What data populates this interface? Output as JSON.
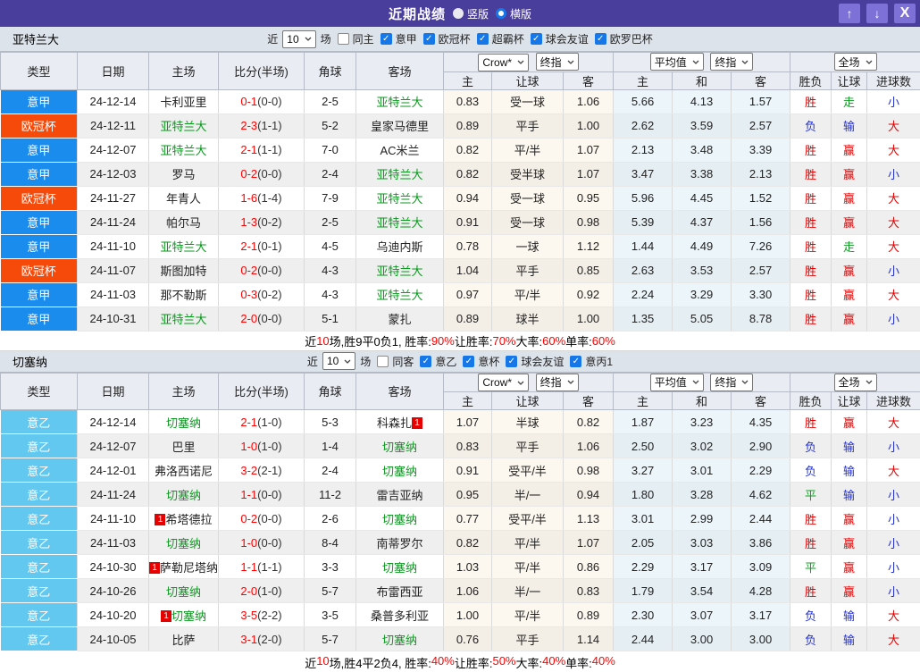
{
  "titlebar": {
    "title": "近期战绩",
    "radios": [
      {
        "label": "竖版",
        "style": "filled"
      },
      {
        "label": "横版",
        "style": "ring"
      }
    ],
    "up_icon": "↑",
    "down_icon": "↓",
    "close_icon": "X"
  },
  "header": {
    "type": "类型",
    "date": "日期",
    "home": "主场",
    "score": "比分(半场)",
    "corner": "角球",
    "away": "客场",
    "odds_company": "Crow*",
    "odds_mode": "终指",
    "avg_label": "平均值",
    "avg_mode": "终指",
    "scope_label": "全场",
    "odds_home": "主",
    "odds_handicap": "让球",
    "odds_away": "客",
    "avg_home": "主",
    "avg_draw": "和",
    "avg_away": "客",
    "res_winloss": "胜负",
    "res_handicap": "让球",
    "res_goals": "进球数"
  },
  "colors": {
    "titlebar": "#4a3e9d",
    "accent_red": "#ff0000",
    "team_green": "#0a9a1e",
    "leagues": {
      "意甲": "#1a8ced",
      "欧冠杯": "#f54a0a",
      "意乙": "#62c8ef"
    },
    "outcomes": {
      "胜": "#e60000",
      "平": "#0f9d23",
      "负": "#2633cc",
      "赢": "#e60000",
      "输": "#2633cc",
      "走": "#0f9d23",
      "大": "#e60000",
      "小": "#2633cc"
    }
  },
  "sections": [
    {
      "team": "亚特兰大",
      "filter": {
        "near_label": "近",
        "count": "10",
        "games_label": "场",
        "same": {
          "label": "同主",
          "checked": false
        },
        "leagues": [
          {
            "label": "意甲",
            "checked": true
          },
          {
            "label": "欧冠杯",
            "checked": true
          },
          {
            "label": "超霸杯",
            "checked": true
          },
          {
            "label": "球会友谊",
            "checked": true
          },
          {
            "label": "欧罗巴杯",
            "checked": true
          }
        ]
      },
      "rows": [
        {
          "lg": "意甲",
          "d": "24-12-14",
          "h": "卡利亚里",
          "hg": false,
          "s": "0-1",
          "sh": "(0-0)",
          "cn": "2-5",
          "a": "亚特兰大",
          "ag": true,
          "o1": "0.83",
          "hc": "受一球",
          "o2": "1.06",
          "m1": "5.66",
          "m2": "4.13",
          "m3": "1.57",
          "wl": "胜",
          "hd": "走",
          "gl": "小"
        },
        {
          "lg": "欧冠杯",
          "d": "24-12-11",
          "h": "亚特兰大",
          "hg": true,
          "s": "2-3",
          "sh": "(1-1)",
          "cn": "5-2",
          "a": "皇家马德里",
          "ag": false,
          "o1": "0.89",
          "hc": "平手",
          "o2": "1.00",
          "m1": "2.62",
          "m2": "3.59",
          "m3": "2.57",
          "wl": "负",
          "hd": "输",
          "gl": "大"
        },
        {
          "lg": "意甲",
          "d": "24-12-07",
          "h": "亚特兰大",
          "hg": true,
          "s": "2-1",
          "sh": "(1-1)",
          "cn": "7-0",
          "a": "AC米兰",
          "ag": false,
          "o1": "0.82",
          "hc": "平/半",
          "o2": "1.07",
          "m1": "2.13",
          "m2": "3.48",
          "m3": "3.39",
          "wl": "胜",
          "hd": "赢",
          "gl": "大"
        },
        {
          "lg": "意甲",
          "d": "24-12-03",
          "h": "罗马",
          "hg": false,
          "s": "0-2",
          "sh": "(0-0)",
          "cn": "2-4",
          "a": "亚特兰大",
          "ag": true,
          "o1": "0.82",
          "hc": "受半球",
          "o2": "1.07",
          "m1": "3.47",
          "m2": "3.38",
          "m3": "2.13",
          "wl": "胜",
          "hd": "赢",
          "gl": "小"
        },
        {
          "lg": "欧冠杯",
          "d": "24-11-27",
          "h": "年青人",
          "hg": false,
          "s": "1-6",
          "sh": "(1-4)",
          "cn": "7-9",
          "a": "亚特兰大",
          "ag": true,
          "o1": "0.94",
          "hc": "受一球",
          "o2": "0.95",
          "m1": "5.96",
          "m2": "4.45",
          "m3": "1.52",
          "wl": "胜",
          "hd": "赢",
          "gl": "大"
        },
        {
          "lg": "意甲",
          "d": "24-11-24",
          "h": "帕尔马",
          "hg": false,
          "s": "1-3",
          "sh": "(0-2)",
          "cn": "2-5",
          "a": "亚特兰大",
          "ag": true,
          "o1": "0.91",
          "hc": "受一球",
          "o2": "0.98",
          "m1": "5.39",
          "m2": "4.37",
          "m3": "1.56",
          "wl": "胜",
          "hd": "赢",
          "gl": "大"
        },
        {
          "lg": "意甲",
          "d": "24-11-10",
          "h": "亚特兰大",
          "hg": true,
          "s": "2-1",
          "sh": "(0-1)",
          "cn": "4-5",
          "a": "乌迪内斯",
          "ag": false,
          "o1": "0.78",
          "hc": "一球",
          "o2": "1.12",
          "m1": "1.44",
          "m2": "4.49",
          "m3": "7.26",
          "wl": "胜",
          "hd": "走",
          "gl": "大"
        },
        {
          "lg": "欧冠杯",
          "d": "24-11-07",
          "h": "斯图加特",
          "hg": false,
          "s": "0-2",
          "sh": "(0-0)",
          "cn": "4-3",
          "a": "亚特兰大",
          "ag": true,
          "o1": "1.04",
          "hc": "平手",
          "o2": "0.85",
          "m1": "2.63",
          "m2": "3.53",
          "m3": "2.57",
          "wl": "胜",
          "hd": "赢",
          "gl": "小"
        },
        {
          "lg": "意甲",
          "d": "24-11-03",
          "h": "那不勒斯",
          "hg": false,
          "s": "0-3",
          "sh": "(0-2)",
          "cn": "4-3",
          "a": "亚特兰大",
          "ag": true,
          "o1": "0.97",
          "hc": "平/半",
          "o2": "0.92",
          "m1": "2.24",
          "m2": "3.29",
          "m3": "3.30",
          "wl": "胜",
          "hd": "赢",
          "gl": "大"
        },
        {
          "lg": "意甲",
          "d": "24-10-31",
          "h": "亚特兰大",
          "hg": true,
          "s": "2-0",
          "sh": "(0-0)",
          "cn": "5-1",
          "a": "蒙扎",
          "ag": false,
          "o1": "0.89",
          "hc": "球半",
          "o2": "1.00",
          "m1": "1.35",
          "m2": "5.05",
          "m3": "8.78",
          "wl": "胜",
          "hd": "赢",
          "gl": "小"
        }
      ],
      "summary": [
        {
          "t": "近"
        },
        {
          "t": "10",
          "red": true
        },
        {
          "t": "场,胜9平0负1, 胜率:"
        },
        {
          "t": "90%",
          "red": true
        },
        {
          "t": " 让胜率:"
        },
        {
          "t": "70%",
          "red": true
        },
        {
          "t": " 大率:"
        },
        {
          "t": "60%",
          "red": true
        },
        {
          "t": " 单率:"
        },
        {
          "t": "60%",
          "red": true
        }
      ]
    },
    {
      "team": "切塞纳",
      "filter": {
        "near_label": "近",
        "count": "10",
        "games_label": "场",
        "same": {
          "label": "同客",
          "checked": false
        },
        "leagues": [
          {
            "label": "意乙",
            "checked": true
          },
          {
            "label": "意杯",
            "checked": true
          },
          {
            "label": "球会友谊",
            "checked": true
          },
          {
            "label": "意丙1",
            "checked": true
          }
        ]
      },
      "rows": [
        {
          "lg": "意乙",
          "d": "24-12-14",
          "h": "切塞纳",
          "hg": true,
          "s": "2-1",
          "sh": "(1-0)",
          "cn": "5-3",
          "a": "科森扎",
          "ag": false,
          "aa": "1",
          "o1": "1.07",
          "hc": "半球",
          "o2": "0.82",
          "m1": "1.87",
          "m2": "3.23",
          "m3": "4.35",
          "wl": "胜",
          "hd": "赢",
          "gl": "大"
        },
        {
          "lg": "意乙",
          "d": "24-12-07",
          "h": "巴里",
          "hg": false,
          "s": "1-0",
          "sh": "(1-0)",
          "cn": "1-4",
          "a": "切塞纳",
          "ag": true,
          "o1": "0.83",
          "hc": "平手",
          "o2": "1.06",
          "m1": "2.50",
          "m2": "3.02",
          "m3": "2.90",
          "wl": "负",
          "hd": "输",
          "gl": "小"
        },
        {
          "lg": "意乙",
          "d": "24-12-01",
          "h": "弗洛西诺尼",
          "hg": false,
          "s": "3-2",
          "sh": "(2-1)",
          "cn": "2-4",
          "a": "切塞纳",
          "ag": true,
          "o1": "0.91",
          "hc": "受平/半",
          "o2": "0.98",
          "m1": "3.27",
          "m2": "3.01",
          "m3": "2.29",
          "wl": "负",
          "hd": "输",
          "gl": "大"
        },
        {
          "lg": "意乙",
          "d": "24-11-24",
          "h": "切塞纳",
          "hg": true,
          "s": "1-1",
          "sh": "(0-0)",
          "cn": "11-2",
          "a": "雷吉亚纳",
          "ag": false,
          "o1": "0.95",
          "hc": "半/一",
          "o2": "0.94",
          "m1": "1.80",
          "m2": "3.28",
          "m3": "4.62",
          "wl": "平",
          "hd": "输",
          "gl": "小"
        },
        {
          "lg": "意乙",
          "d": "24-11-10",
          "h": "希塔德拉",
          "hg": false,
          "hb": "1",
          "s": "0-2",
          "sh": "(0-0)",
          "cn": "2-6",
          "a": "切塞纳",
          "ag": true,
          "o1": "0.77",
          "hc": "受平/半",
          "o2": "1.13",
          "m1": "3.01",
          "m2": "2.99",
          "m3": "2.44",
          "wl": "胜",
          "hd": "赢",
          "gl": "小"
        },
        {
          "lg": "意乙",
          "d": "24-11-03",
          "h": "切塞纳",
          "hg": true,
          "s": "1-0",
          "sh": "(0-0)",
          "cn": "8-4",
          "a": "南蒂罗尔",
          "ag": false,
          "o1": "0.82",
          "hc": "平/半",
          "o2": "1.07",
          "m1": "2.05",
          "m2": "3.03",
          "m3": "3.86",
          "wl": "胜",
          "hd": "赢",
          "gl": "小"
        },
        {
          "lg": "意乙",
          "d": "24-10-30",
          "h": "萨勒尼塔纳",
          "hg": false,
          "hb": "1",
          "s": "1-1",
          "sh": "(1-1)",
          "cn": "3-3",
          "a": "切塞纳",
          "ag": true,
          "o1": "1.03",
          "hc": "平/半",
          "o2": "0.86",
          "m1": "2.29",
          "m2": "3.17",
          "m3": "3.09",
          "wl": "平",
          "hd": "赢",
          "gl": "小"
        },
        {
          "lg": "意乙",
          "d": "24-10-26",
          "h": "切塞纳",
          "hg": true,
          "s": "2-0",
          "sh": "(1-0)",
          "cn": "5-7",
          "a": "布雷西亚",
          "ag": false,
          "o1": "1.06",
          "hc": "半/一",
          "o2": "0.83",
          "m1": "1.79",
          "m2": "3.54",
          "m3": "4.28",
          "wl": "胜",
          "hd": "赢",
          "gl": "小"
        },
        {
          "lg": "意乙",
          "d": "24-10-20",
          "h": "切塞纳",
          "hg": true,
          "hb": "1",
          "s": "3-5",
          "sh": "(2-2)",
          "cn": "3-5",
          "a": "桑普多利亚",
          "ag": false,
          "o1": "1.00",
          "hc": "平/半",
          "o2": "0.89",
          "m1": "2.30",
          "m2": "3.07",
          "m3": "3.17",
          "wl": "负",
          "hd": "输",
          "gl": "大"
        },
        {
          "lg": "意乙",
          "d": "24-10-05",
          "h": "比萨",
          "hg": false,
          "s": "3-1",
          "sh": "(2-0)",
          "cn": "5-7",
          "a": "切塞纳",
          "ag": true,
          "o1": "0.76",
          "hc": "平手",
          "o2": "1.14",
          "m1": "2.44",
          "m2": "3.00",
          "m3": "3.00",
          "wl": "负",
          "hd": "输",
          "gl": "大"
        }
      ],
      "summary": [
        {
          "t": "近"
        },
        {
          "t": "10",
          "red": true
        },
        {
          "t": "场,胜4平2负4, 胜率:"
        },
        {
          "t": "40%",
          "red": true
        },
        {
          "t": " 让胜率:"
        },
        {
          "t": "50%",
          "red": true
        },
        {
          "t": " 大率:"
        },
        {
          "t": "40%",
          "red": true
        },
        {
          "t": " 单率:"
        },
        {
          "t": "40%",
          "red": true
        }
      ]
    }
  ]
}
